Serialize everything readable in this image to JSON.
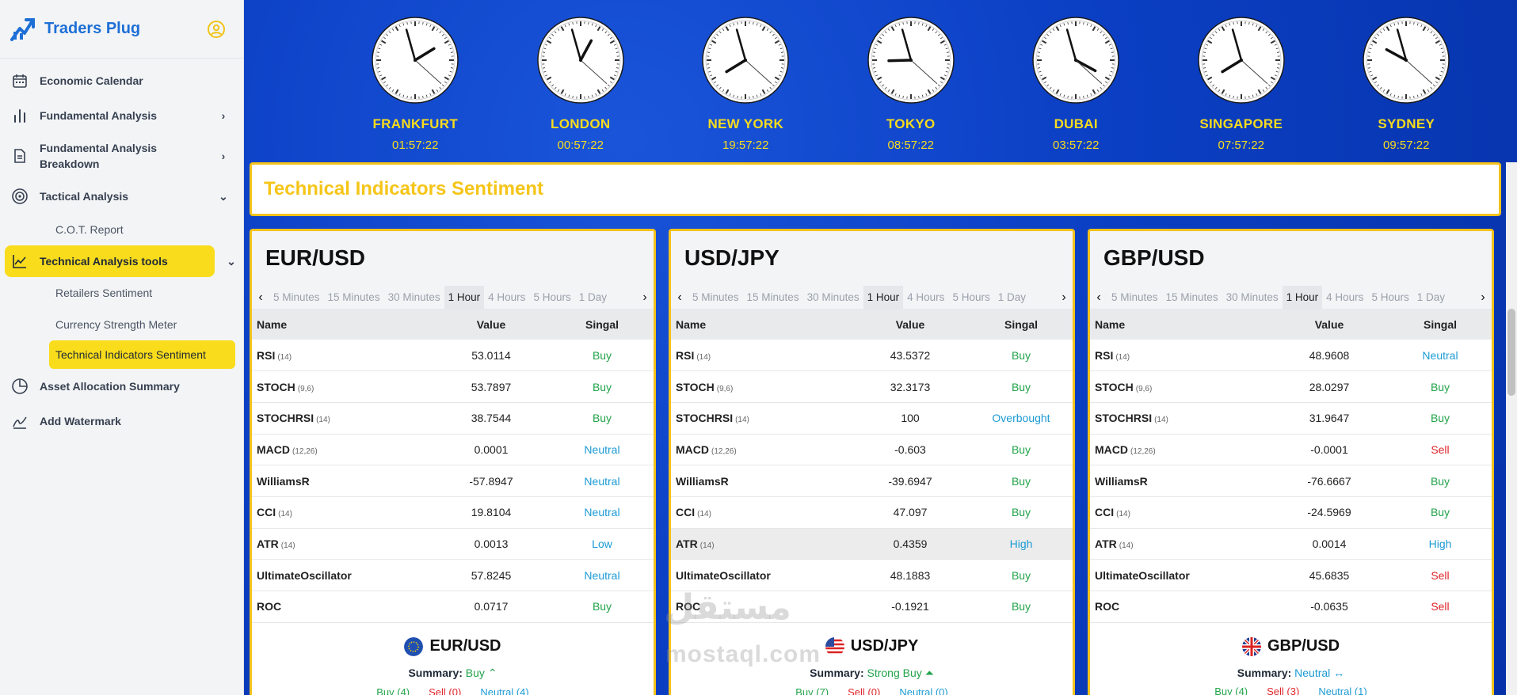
{
  "brand": {
    "name": "Traders Plug"
  },
  "colors": {
    "accent": "#f9dc1c",
    "brand": "#1d6fd6",
    "buy": "#22a34a",
    "sell": "#e0262b",
    "neutral": "#1c9bd4",
    "main_bg": "#0b3fc4"
  },
  "sidebar": {
    "items": [
      {
        "label": "Economic Calendar",
        "icon": "calendar-icon"
      },
      {
        "label": "Fundamental Analysis",
        "icon": "bar-chart-icon"
      },
      {
        "label": "Fundamental Analysis Breakdown",
        "icon": "document-icon"
      },
      {
        "label": "Tactical Analysis",
        "icon": "target-icon"
      },
      {
        "label": "C.O.T. Report"
      },
      {
        "label": "Technical Analysis tools",
        "icon": "line-chart-icon"
      },
      {
        "label": "Retailers Sentiment"
      },
      {
        "label": "Currency Strength Meter"
      },
      {
        "label": "Technical Indicators Sentiment"
      },
      {
        "label": "Asset Allocation Summary",
        "icon": "pie-chart-icon"
      },
      {
        "label": "Add Watermark",
        "icon": "signature-icon"
      }
    ]
  },
  "clocks": [
    {
      "city": "FRANKFURT",
      "time": "01:57:22"
    },
    {
      "city": "LONDON",
      "time": "00:57:22"
    },
    {
      "city": "NEW YORK",
      "time": "19:57:22"
    },
    {
      "city": "TOKYO",
      "time": "08:57:22"
    },
    {
      "city": "DUBAI",
      "time": "03:57:22"
    },
    {
      "city": "SINGAPORE",
      "time": "07:57:22"
    },
    {
      "city": "SYDNEY",
      "time": "09:57:22"
    }
  ],
  "banner": {
    "title": "Technical Indicators Sentiment"
  },
  "table_headers": {
    "name": "Name",
    "value": "Value",
    "signal": "Singal"
  },
  "timeframes": [
    "5 Minutes",
    "15 Minutes",
    "30 Minutes",
    "1 Hour",
    "4 Hours",
    "5 Hours",
    "1 Day"
  ],
  "active_timeframe": "1 Hour",
  "summary_label": "Summary:",
  "panels": [
    {
      "pair": "EUR/USD",
      "flag": "eu-flag-icon",
      "rows": [
        {
          "name": "RSI",
          "param": "(14)",
          "value": "53.0114",
          "signal": "Buy",
          "kind": "buy"
        },
        {
          "name": "STOCH",
          "param": "(9,6)",
          "value": "53.7897",
          "signal": "Buy",
          "kind": "buy"
        },
        {
          "name": "STOCHRSI",
          "param": "(14)",
          "value": "38.7544",
          "signal": "Buy",
          "kind": "buy"
        },
        {
          "name": "MACD",
          "param": "(12,26)",
          "value": "0.0001",
          "signal": "Neutral",
          "kind": "neutral"
        },
        {
          "name": "WilliamsR",
          "param": "",
          "value": "-57.8947",
          "signal": "Neutral",
          "kind": "neutral"
        },
        {
          "name": "CCI",
          "param": "(14)",
          "value": "19.8104",
          "signal": "Neutral",
          "kind": "neutral"
        },
        {
          "name": "ATR",
          "param": "(14)",
          "value": "0.0013",
          "signal": "Low",
          "kind": "low"
        },
        {
          "name": "UltimateOscillator",
          "param": "",
          "value": "57.8245",
          "signal": "Neutral",
          "kind": "neutral"
        },
        {
          "name": "ROC",
          "param": "",
          "value": "0.0717",
          "signal": "Buy",
          "kind": "buy"
        }
      ],
      "summary": {
        "title": "EUR/USD",
        "verdict": "Buy",
        "kind": "buy",
        "arrow": "⌃",
        "buy": "Buy (4)",
        "sell": "Sell (0)",
        "neutral": "Neutral (4)"
      }
    },
    {
      "pair": "USD/JPY",
      "flag": "us-flag-icon",
      "rows": [
        {
          "name": "RSI",
          "param": "(14)",
          "value": "43.5372",
          "signal": "Buy",
          "kind": "buy"
        },
        {
          "name": "STOCH",
          "param": "(9,6)",
          "value": "32.3173",
          "signal": "Buy",
          "kind": "buy"
        },
        {
          "name": "STOCHRSI",
          "param": "(14)",
          "value": "100",
          "signal": "Overbought",
          "kind": "overbought"
        },
        {
          "name": "MACD",
          "param": "(12,26)",
          "value": "-0.603",
          "signal": "Buy",
          "kind": "buy"
        },
        {
          "name": "WilliamsR",
          "param": "",
          "value": "-39.6947",
          "signal": "Buy",
          "kind": "buy"
        },
        {
          "name": "CCI",
          "param": "(14)",
          "value": "47.097",
          "signal": "Buy",
          "kind": "buy"
        },
        {
          "name": "ATR",
          "param": "(14)",
          "value": "0.4359",
          "signal": "High",
          "kind": "high",
          "hl": true
        },
        {
          "name": "UltimateOscillator",
          "param": "",
          "value": "48.1883",
          "signal": "Buy",
          "kind": "buy"
        },
        {
          "name": "ROC",
          "param": "",
          "value": "-0.1921",
          "signal": "Buy",
          "kind": "buy"
        }
      ],
      "summary": {
        "title": "USD/JPY",
        "verdict": "Strong Buy",
        "kind": "buy",
        "arrow": "⏶",
        "buy": "Buy (7)",
        "sell": "Sell (0)",
        "neutral": "Neutral (0)"
      }
    },
    {
      "pair": "GBP/USD",
      "flag": "uk-flag-icon",
      "rows": [
        {
          "name": "RSI",
          "param": "(14)",
          "value": "48.9608",
          "signal": "Neutral",
          "kind": "neutral"
        },
        {
          "name": "STOCH",
          "param": "(9,6)",
          "value": "28.0297",
          "signal": "Buy",
          "kind": "buy"
        },
        {
          "name": "STOCHRSI",
          "param": "(14)",
          "value": "31.9647",
          "signal": "Buy",
          "kind": "buy"
        },
        {
          "name": "MACD",
          "param": "(12,26)",
          "value": "-0.0001",
          "signal": "Sell",
          "kind": "sell"
        },
        {
          "name": "WilliamsR",
          "param": "",
          "value": "-76.6667",
          "signal": "Buy",
          "kind": "buy"
        },
        {
          "name": "CCI",
          "param": "(14)",
          "value": "-24.5969",
          "signal": "Buy",
          "kind": "buy"
        },
        {
          "name": "ATR",
          "param": "(14)",
          "value": "0.0014",
          "signal": "High",
          "kind": "high"
        },
        {
          "name": "UltimateOscillator",
          "param": "",
          "value": "45.6835",
          "signal": "Sell",
          "kind": "sell"
        },
        {
          "name": "ROC",
          "param": "",
          "value": "-0.0635",
          "signal": "Sell",
          "kind": "sell"
        }
      ],
      "summary": {
        "title": "GBP/USD",
        "verdict": "Neutral",
        "kind": "neutral",
        "arrow": "↔",
        "buy": "Buy (4)",
        "sell": "Sell (3)",
        "neutral": "Neutral (1)"
      }
    }
  ],
  "watermark": {
    "arabic": "مستقل",
    "latin": "mostaql.com"
  }
}
